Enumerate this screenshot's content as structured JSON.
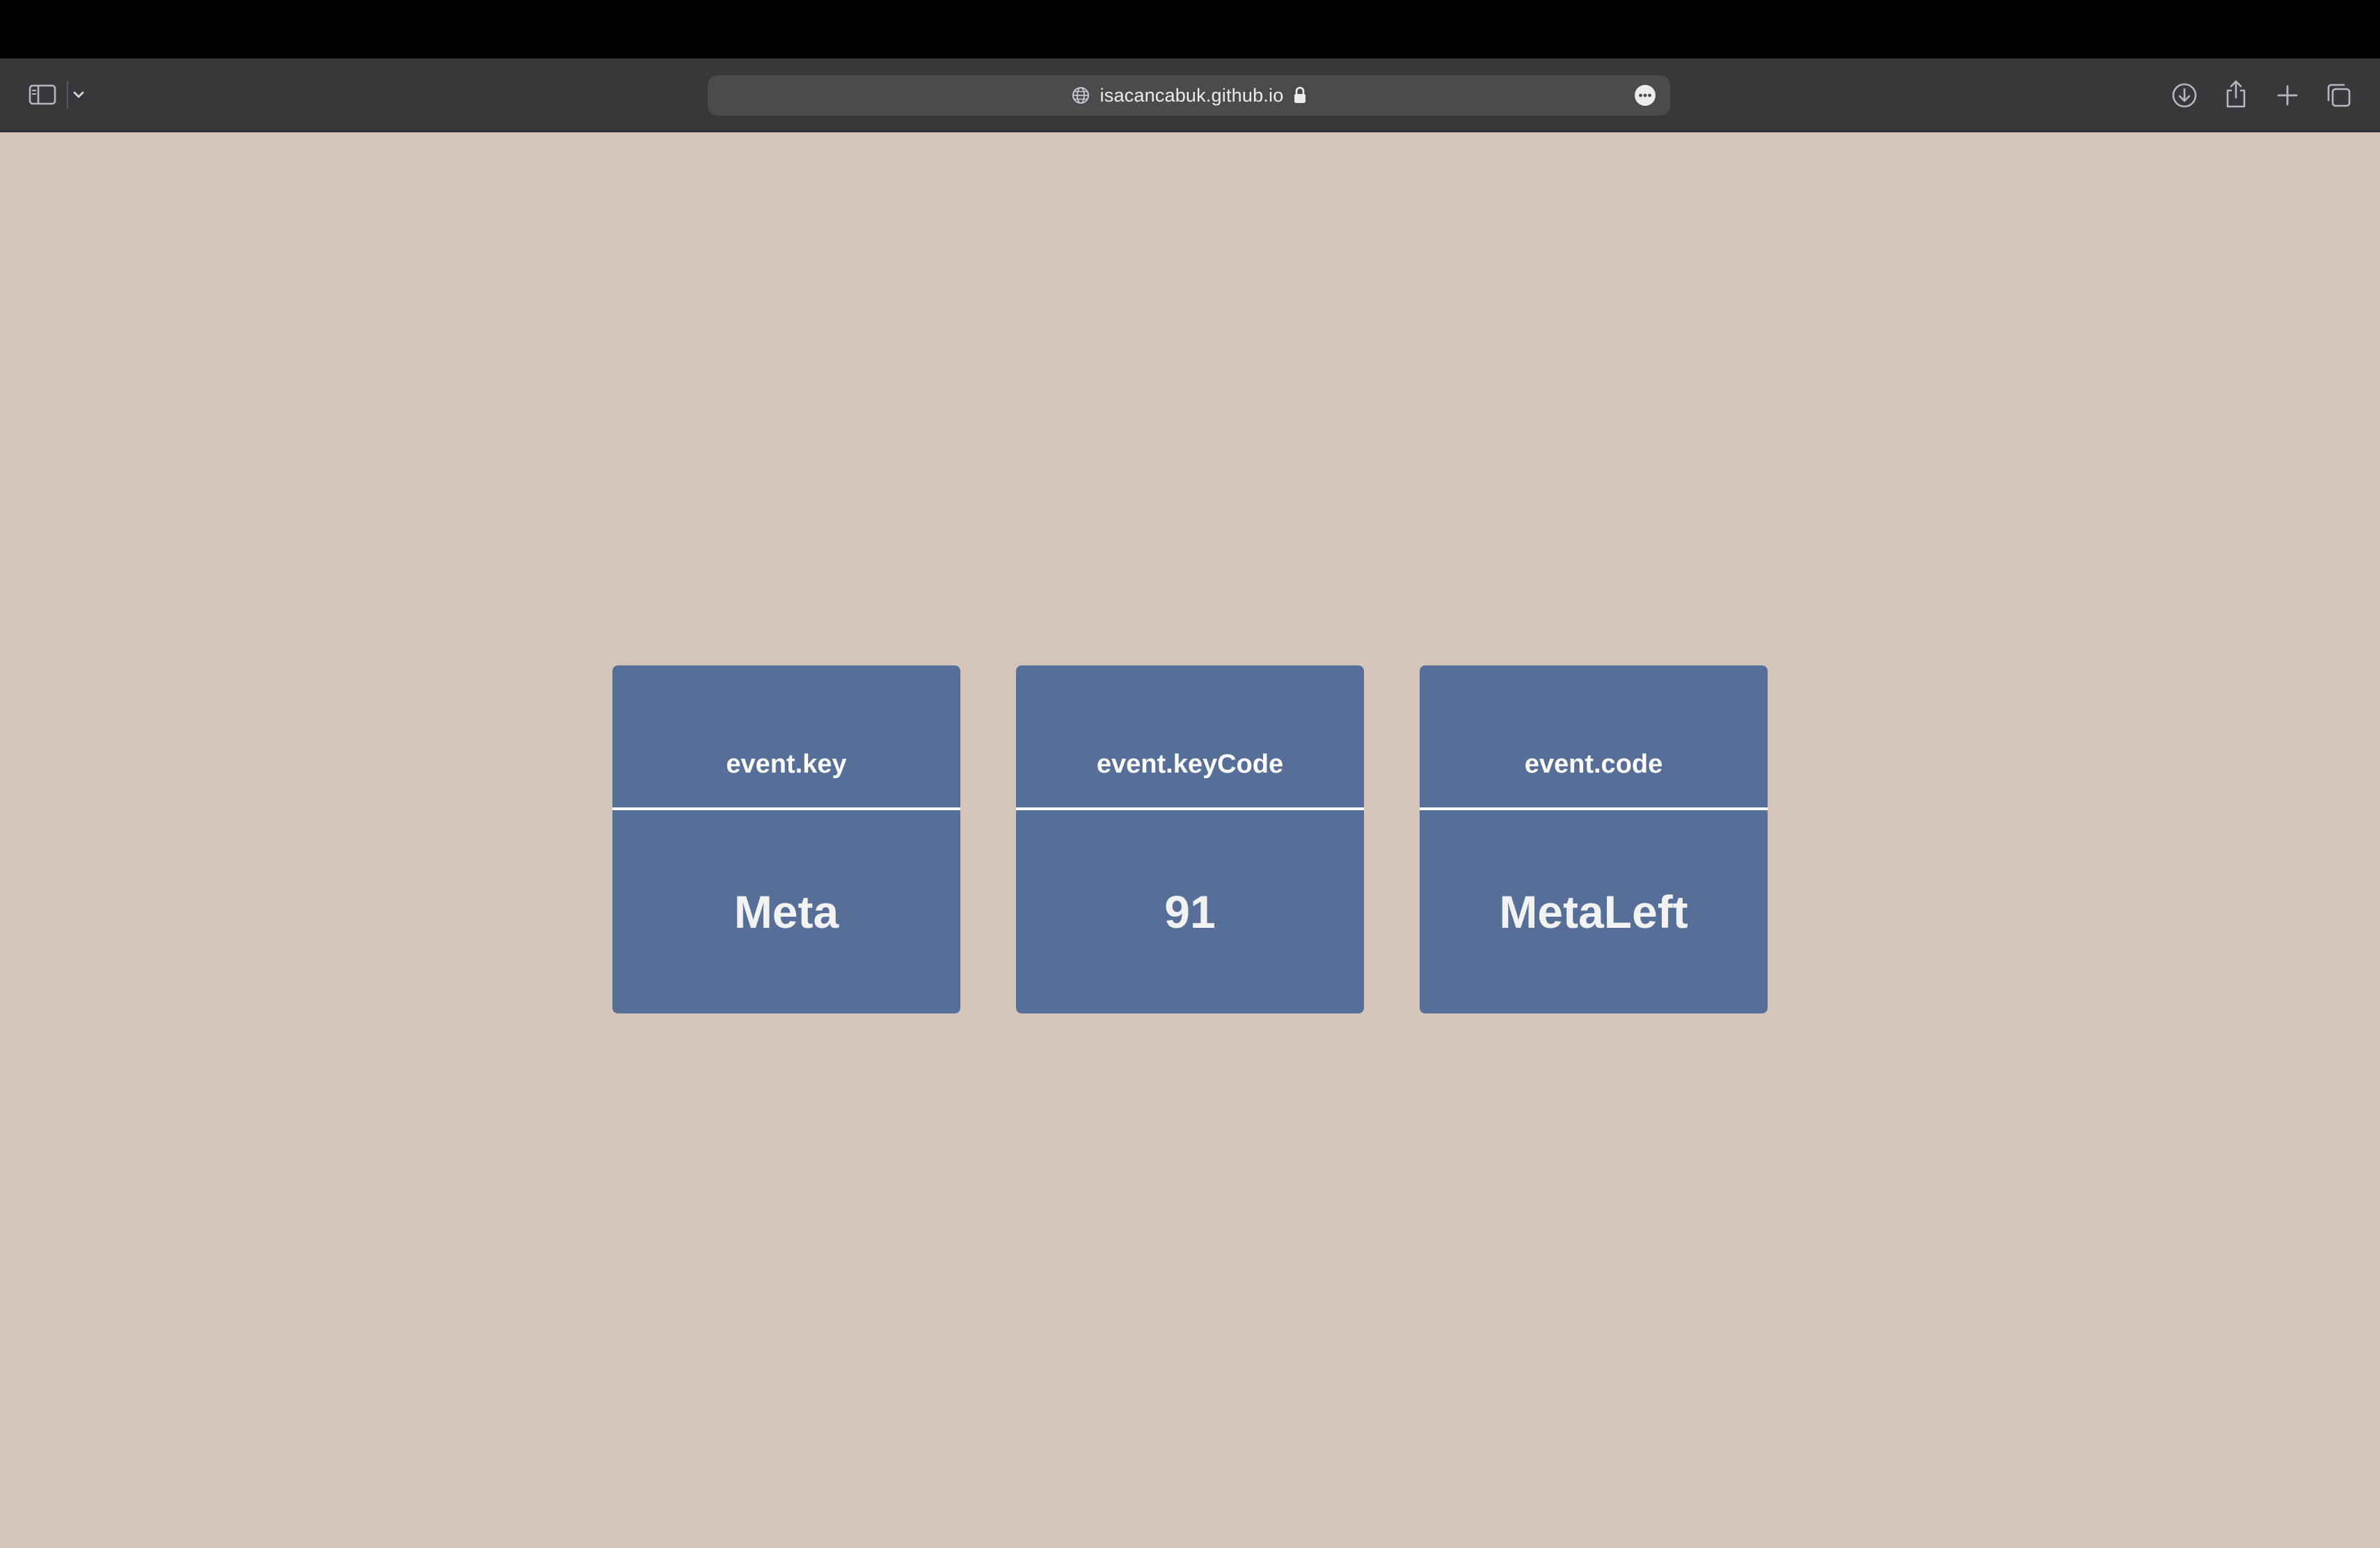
{
  "browser": {
    "url": "isacancabuk.github.io",
    "icons": {
      "sidebar": "sidebar-icon",
      "chevron": "chevron-down-icon",
      "site": "globe-icon",
      "secure": "lock-icon",
      "page_menu": "more-icon",
      "downloads": "download-icon",
      "share": "share-icon",
      "new_tab": "plus-icon",
      "tab_overview": "tabs-icon"
    }
  },
  "colors": {
    "page_background": "#d5c5b8",
    "card_background": "#566f98",
    "card_text": "#ffffff",
    "toolbar_background": "#38383a"
  },
  "cards": [
    {
      "label": "event.key",
      "value": "Meta"
    },
    {
      "label": "event.keyCode",
      "value": "91"
    },
    {
      "label": "event.code",
      "value": "MetaLeft"
    }
  ]
}
